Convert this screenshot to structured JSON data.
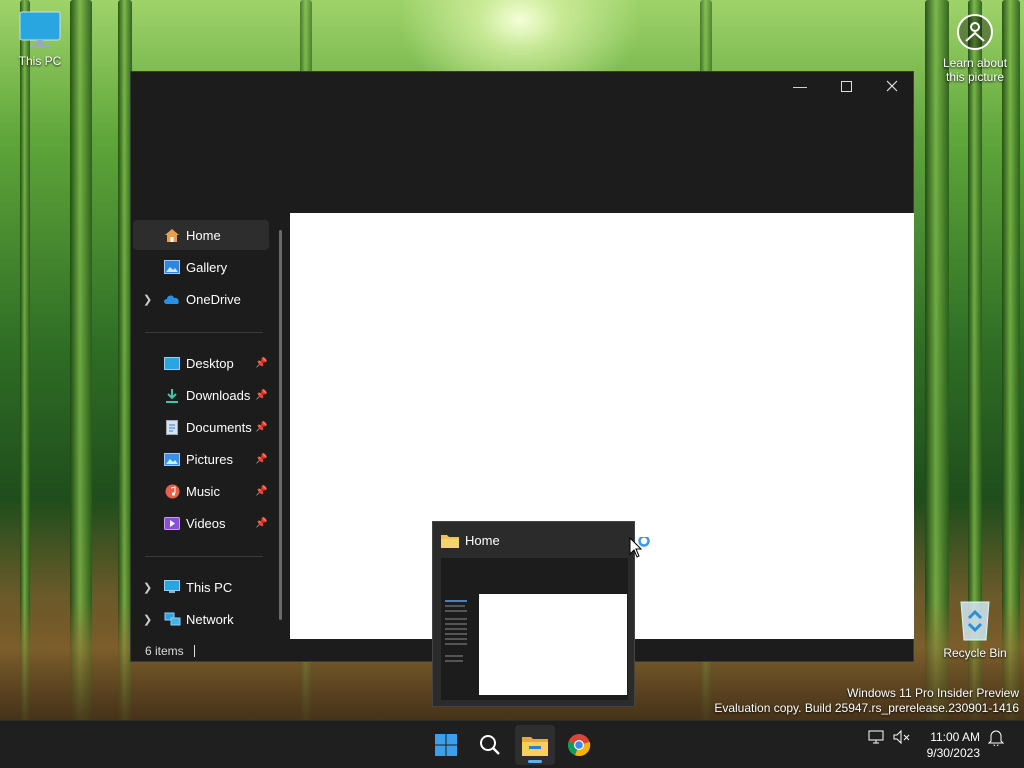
{
  "desktop": {
    "this_pc_label": "This PC",
    "learn_label_line1": "Learn about",
    "learn_label_line2": "this picture",
    "recycle_label": "Recycle Bin"
  },
  "explorer": {
    "nav": {
      "home": "Home",
      "gallery": "Gallery",
      "onedrive": "OneDrive",
      "desktop": "Desktop",
      "downloads": "Downloads",
      "documents": "Documents",
      "pictures": "Pictures",
      "music": "Music",
      "videos": "Videos",
      "thispc": "This PC",
      "network": "Network"
    },
    "status_text": "6 items"
  },
  "preview": {
    "title": "Home"
  },
  "watermark": {
    "line1": "Windows 11 Pro Insider Preview",
    "line2": "Evaluation copy. Build 25947.rs_prerelease.230901-1416"
  },
  "taskbar": {
    "time": "11:00 AM",
    "date": "9/30/2023"
  },
  "colors": {
    "accent": "#5ab0f0",
    "window_bg": "#1c1c1c",
    "taskbar_bg": "#1f1f1f"
  }
}
